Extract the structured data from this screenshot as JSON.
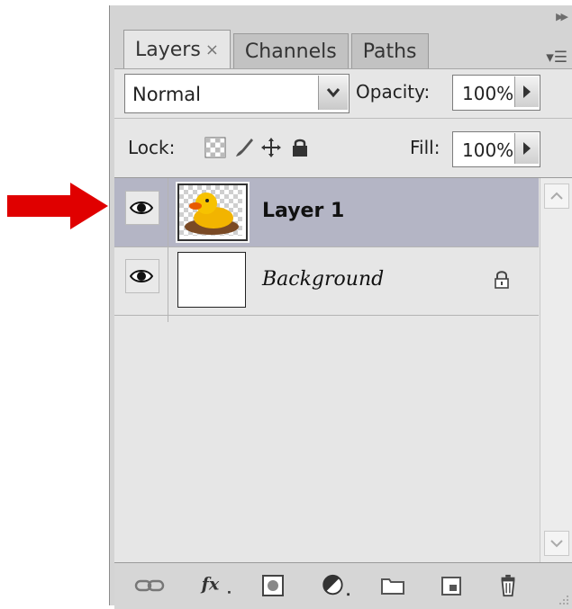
{
  "annotation": {
    "arrow_color": "#e00000",
    "arrow_icon": "right-arrow-icon"
  },
  "panel": {
    "tabs": [
      {
        "label": "Layers",
        "active": true,
        "close_glyph": "×"
      },
      {
        "label": "Channels",
        "active": false
      },
      {
        "label": "Paths",
        "active": false
      }
    ],
    "blend_mode": {
      "value": "Normal"
    },
    "opacity": {
      "label": "Opacity:",
      "value": "100%"
    },
    "lock": {
      "label": "Lock:",
      "icons": [
        "lock-transparent-icon",
        "lock-image-icon",
        "lock-position-icon",
        "lock-all-icon"
      ]
    },
    "fill": {
      "label": "Fill:",
      "value": "100%"
    },
    "layers": [
      {
        "name": "Layer 1",
        "selected": true,
        "visible": true,
        "thumbnail": "rubber-duck-icon"
      },
      {
        "name": "Background",
        "selected": false,
        "visible": true,
        "locked": true,
        "thumbnail": "white-fill"
      }
    ],
    "bottom_icons": [
      "link-layers-icon",
      "fx-icon",
      "add-mask-icon",
      "adjustment-layer-icon",
      "group-folder-icon",
      "new-layer-icon",
      "trash-icon"
    ],
    "colors": {
      "selected_row": "#b4b5c5",
      "panel_bg": "#e6e6e6"
    }
  }
}
